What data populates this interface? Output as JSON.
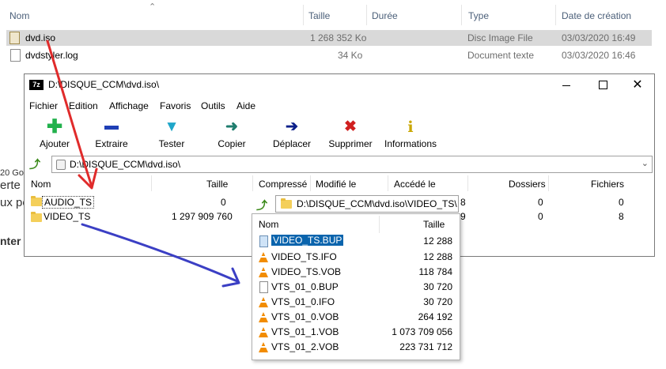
{
  "explorer": {
    "columns": {
      "name": "Nom",
      "size": "Taille",
      "duration": "Durée",
      "type": "Type",
      "date": "Date de création"
    },
    "files": [
      {
        "name": "dvd.iso",
        "size": "1 268 352 Ko",
        "type": "Disc Image File",
        "date": "03/03/2020 16:49",
        "selected": true
      },
      {
        "name": "dvdstyler.log",
        "size": "34 Ko",
        "type": "Document texte",
        "date": "03/03/2020 16:46",
        "selected": false
      }
    ],
    "background_fragments": {
      "left1": "20 Go",
      "left2": "erte",
      "left3": "ux po",
      "left4": "nter"
    }
  },
  "sevenzip": {
    "app_badge": "7z",
    "title": "D:\\DISQUE_CCM\\dvd.iso\\",
    "menu": [
      "Fichier",
      "Edition",
      "Affichage",
      "Favoris",
      "Outils",
      "Aide"
    ],
    "toolbar": [
      {
        "label": "Ajouter",
        "icon": "plus-icon",
        "color": "#22b14c"
      },
      {
        "label": "Extraire",
        "icon": "minus-icon",
        "color": "#1f3fb5"
      },
      {
        "label": "Tester",
        "icon": "check-icon",
        "color": "#1fa6c9"
      },
      {
        "label": "Copier",
        "icon": "copy-arrow-icon",
        "color": "#1f7d6e"
      },
      {
        "label": "Déplacer",
        "icon": "move-arrow-icon",
        "color": "#0b1f8a"
      },
      {
        "label": "Supprimer",
        "icon": "delete-x-icon",
        "color": "#d01f1f"
      },
      {
        "label": "Informations",
        "icon": "info-icon",
        "color": "#c9a700"
      }
    ],
    "address": "D:\\DISQUE_CCM\\dvd.iso\\",
    "columns": {
      "name": "Nom",
      "size": "Taille",
      "compressed": "Compressé",
      "modified": "Modifié le",
      "accessed": "Accédé le",
      "folders": "Dossiers",
      "files": "Fichiers"
    },
    "rows": [
      {
        "name": "AUDIO_TS",
        "size": "0",
        "folders": "0",
        "files": "0",
        "partial_a": "8"
      },
      {
        "name": "VIDEO_TS",
        "size": "1 297 909 760",
        "folders": "0",
        "files": "8",
        "partial_a": "9"
      }
    ]
  },
  "popup": {
    "address": "D:\\DISQUE_CCM\\dvd.iso\\VIDEO_TS\\",
    "columns": {
      "name": "Nom",
      "size": "Taille"
    },
    "files": [
      {
        "name": "VIDEO_TS.BUP",
        "size": "12 288",
        "icon": "file",
        "selected": true
      },
      {
        "name": "VIDEO_TS.IFO",
        "size": "12 288",
        "icon": "vlc"
      },
      {
        "name": "VIDEO_TS.VOB",
        "size": "118 784",
        "icon": "vlc"
      },
      {
        "name": "VTS_01_0.BUP",
        "size": "30 720",
        "icon": "file"
      },
      {
        "name": "VTS_01_0.IFO",
        "size": "30 720",
        "icon": "vlc"
      },
      {
        "name": "VTS_01_0.VOB",
        "size": "264 192",
        "icon": "vlc"
      },
      {
        "name": "VTS_01_1.VOB",
        "size": "1 073 709 056",
        "icon": "vlc"
      },
      {
        "name": "VTS_01_2.VOB",
        "size": "223 731 712",
        "icon": "vlc"
      }
    ]
  },
  "annotations": {
    "arrow1_color": "#e02b2b",
    "arrow2_color": "#3b3fc4"
  }
}
